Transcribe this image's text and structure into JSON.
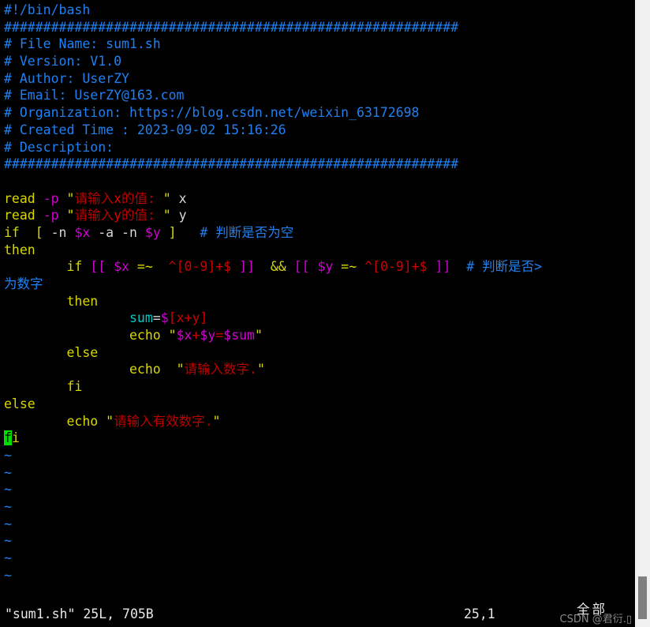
{
  "editor": {
    "name": "vim",
    "background": "#000000",
    "filename": "sum1.sh",
    "lines": [
      "#!/bin/bash",
      "##########################################################",
      "# File Name: sum1.sh",
      "# Version: V1.0",
      "# Author: UserZY",
      "# Email: UserZY@163.com",
      "# Organization: https://blog.csdn.net/weixin_63172698",
      "# Created Time : 2023-09-02 15:16:26",
      "# Description:",
      "##########################################################",
      "",
      "read -p \"请输入x的值: \" x",
      "read -p \"请输入y的值: \" y",
      "if  [ -n $x -a -n $y ]   # 判断是否为空",
      "then",
      "        if [[ $x =~  ^[0-9]+$ ]]  && [[ $y =~ ^[0-9]+$ ]]  # 判断是否为数字",
      "        then",
      "                sum=$[x+y]",
      "                echo \"$x+$y=$sum\"",
      "        else",
      "                echo  \"请输入数字.\"",
      "        fi",
      "else",
      "        echo \"请输入有效数字.\"",
      "fi"
    ],
    "filler_rows": [
      "~",
      "~",
      "~",
      "~",
      "~",
      "~",
      "~",
      "~"
    ],
    "wrap_marker": ">",
    "cursor": {
      "char": "f",
      "line": 25,
      "column": 1,
      "color": "#00e000"
    }
  },
  "code": {
    "l1": {
      "comment": "#!/bin/bash"
    },
    "l2": {
      "comment": "##########################################################"
    },
    "l3": {
      "comment": "# File Name: sum1.sh"
    },
    "l4": {
      "comment": "# Version: V1.0"
    },
    "l5": {
      "comment": "# Author: UserZY"
    },
    "l6": {
      "comment": "# Email: UserZY@163.com"
    },
    "l7": {
      "comment": "# Organization: https://blog.csdn.net/weixin_63172698"
    },
    "l8": {
      "comment": "# Created Time : 2023-09-02 15:16:26"
    },
    "l9": {
      "comment": "# Description:"
    },
    "l10": {
      "comment": "##########################################################"
    },
    "read_x": {
      "kw": "read",
      "sp1": " ",
      "flag": "-p",
      "sp2": " ",
      "q1": "\"",
      "str_a": "请输入",
      "str_var": "x",
      "str_b": "的值: ",
      "q2": "\"",
      "sp3": " ",
      "varname": "x"
    },
    "read_y": {
      "kw": "read",
      "sp1": " ",
      "flag": "-p",
      "sp2": " ",
      "q1": "\"",
      "str_a": "请输入",
      "str_var": "y",
      "str_b": "的值: ",
      "q2": "\"",
      "sp3": " ",
      "varname": "y"
    },
    "if_nonempty": {
      "kw": "if",
      "sp1": "  ",
      "open": "[",
      "t1": " -n ",
      "vx": "$x",
      "t2": " -a -n ",
      "vy": "$y",
      "t3": " ",
      "close": "]",
      "sp2": "   ",
      "comment": "# 判断是否为空"
    },
    "then1": "then",
    "if_numeric": {
      "indent": "        ",
      "kw": "if",
      "sp1": " ",
      "b1": "[[",
      "sp2": " ",
      "vx": "$x",
      "sp3": " ",
      "op": "=~",
      "sp4": "  ",
      "re1": "^[0-9]+$",
      "sp5": " ",
      "b2": "]]",
      "sp6": "  ",
      "and": "&&",
      "sp7": " ",
      "b3": "[[",
      "sp8": " ",
      "vy": "$y",
      "sp9": " ",
      "op2": "=~",
      "sp10": " ",
      "re2": "^[0-9]+$",
      "sp11": " ",
      "b4": "]]",
      "sp12": "  ",
      "comment": "# 判断是否",
      "wrap": ">",
      "wrapped": "为数字"
    },
    "then2": {
      "indent": "        ",
      "kw": "then"
    },
    "sum_assign": {
      "indent": "                ",
      "ident": "sum",
      "eq": "=",
      "dollar": "$",
      "expr": "[x+y]"
    },
    "echo_sum": {
      "indent": "                ",
      "kw": "echo",
      "sp": " ",
      "q1": "\"",
      "vx": "$x",
      "plus": "+",
      "vy": "$y",
      "eq": "=",
      "vsum": "$sum",
      "q2": "\""
    },
    "else1": {
      "indent": "        ",
      "kw": "else"
    },
    "echo_number": {
      "indent": "                ",
      "kw": "echo",
      "sp": "  ",
      "q1": "\"",
      "str": "请输入数字.",
      "q2": "\""
    },
    "fi1": {
      "indent": "        ",
      "kw": "fi"
    },
    "else2": "else",
    "echo_valid": {
      "indent": "        ",
      "kw": "echo",
      "sp": " ",
      "q1": "\"",
      "str": "请输入有效数字.",
      "q2": "\""
    },
    "fi2": {
      "cursor_char": "f",
      "rest": "i"
    }
  },
  "status": {
    "file_info": "\"sum1.sh\" 25L, 705B",
    "position": "25,1",
    "scroll_indicator": "全部"
  },
  "watermark": {
    "text": "CSDN @君衍.▯"
  },
  "colors": {
    "background": "#000000",
    "comment_blue": "#2080f0",
    "keyword_yellow": "#d8d800",
    "variable_magenta": "#d000d0",
    "string_red": "#bb0000",
    "ident_cyan": "#00c8c8",
    "plain_white": "#d8d8d8",
    "cursor_green": "#00e000",
    "scrollbar_track": "#f0f0f0",
    "scrollbar_thumb": "#808080"
  }
}
